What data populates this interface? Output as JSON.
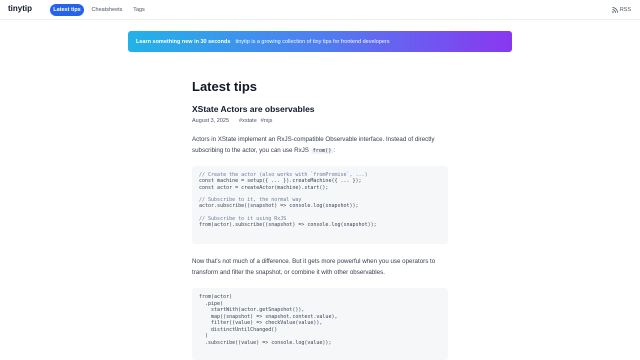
{
  "header": {
    "logo": "tinytip",
    "nav": [
      {
        "label": "Latest tips",
        "active": true
      },
      {
        "label": "Cheatsheets",
        "active": false
      },
      {
        "label": "Tags",
        "active": false
      }
    ],
    "rss_label": "RSS"
  },
  "banner": {
    "strong": "Learn something new in 30 seconds",
    "text": "tinytip is a growing collection of tiny tips for frontend developers"
  },
  "main": {
    "title": "Latest tips",
    "post": {
      "title": "XState Actors are observables",
      "date": "August 3, 2025",
      "tags": [
        "#xstate",
        "#rxjs"
      ],
      "intro_before_code": "Actors in XState implement an RxJS-compatible Observable interface. Instead of directly subscribing to the actor, you can use RxJS ",
      "intro_code": "from()",
      "intro_after_code": ":",
      "code1": [
        {
          "text": "// Create the actor (also works with `fromPromise`, ...)",
          "kind": "comment"
        },
        {
          "text": "const machine = setup({ ... }).createMachine({ ... });",
          "kind": "code"
        },
        {
          "text": "const actor = createActor(machine).start();",
          "kind": "code"
        },
        {
          "text": "",
          "kind": "code"
        },
        {
          "text": "// Subscribe to it, the normal way",
          "kind": "comment"
        },
        {
          "text": "actor.subscribe((snapshot) => console.log(snapshot));",
          "kind": "code"
        },
        {
          "text": "",
          "kind": "code"
        },
        {
          "text": "// Subscribe to it using RxJS",
          "kind": "comment"
        },
        {
          "text": "from(actor).subscribe((snapshot) => console.log(snapshot));",
          "kind": "code"
        }
      ],
      "paragraph2": "Now that's not much of a difference. But it gets more powerful when you use operators to transform and filter the snapshot, or combine it with other observables.",
      "code2": [
        {
          "text": "from(actor)",
          "kind": "code"
        },
        {
          "text": "  .pipe(",
          "kind": "code"
        },
        {
          "text": "    startWith(actor.getSnapshot()),",
          "kind": "code"
        },
        {
          "text": "    map((snapshot) => snapshot.context.value),",
          "kind": "code"
        },
        {
          "text": "    filter((value) => checkValue(value)),",
          "kind": "code"
        },
        {
          "text": "    distinctUntilChanged()",
          "kind": "code"
        },
        {
          "text": "  )",
          "kind": "code"
        },
        {
          "text": "  .subscribe((value) => console.log(value));",
          "kind": "code"
        }
      ]
    }
  }
}
